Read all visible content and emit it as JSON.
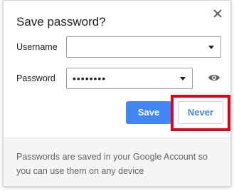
{
  "dialog": {
    "title": "Save password?",
    "close_icon": "close-icon"
  },
  "fields": {
    "username_label": "Username",
    "username_value": "",
    "password_label": "Password",
    "password_value": "••••••••",
    "dropdown_icon": "chevron-down-icon",
    "show_password_icon": "eye-icon"
  },
  "buttons": {
    "save_label": "Save",
    "never_label": "Never"
  },
  "footer": {
    "text": "Passwords are saved in your Google Account so you can use them on any device"
  },
  "colors": {
    "accent": "#4285f4",
    "highlight": "#e0001a"
  }
}
